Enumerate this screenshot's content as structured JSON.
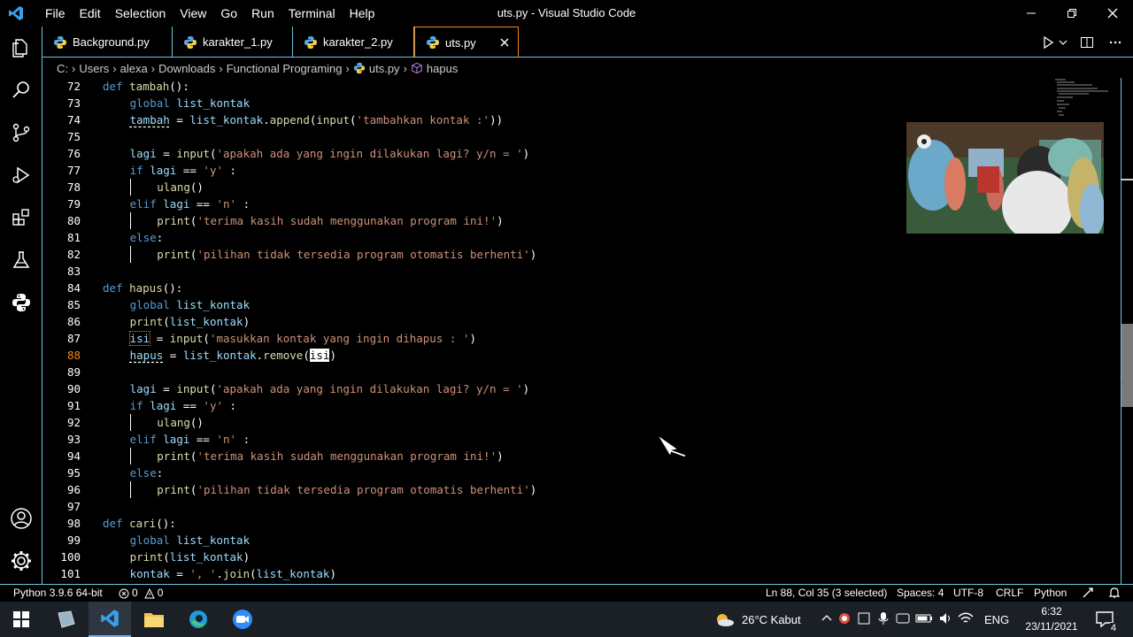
{
  "window": {
    "title": "uts.py - Visual Studio Code",
    "menu": [
      "File",
      "Edit",
      "Selection",
      "View",
      "Go",
      "Run",
      "Terminal",
      "Help"
    ]
  },
  "activity_bar": [
    "explorer-icon",
    "search-icon",
    "source-control-icon",
    "run-debug-icon",
    "extensions-icon",
    "testing-icon",
    "python-icon",
    "account-icon",
    "manage-gear-icon"
  ],
  "tabs": [
    {
      "label": "Background.py",
      "active": false
    },
    {
      "label": "karakter_1.py",
      "active": false
    },
    {
      "label": "karakter_2.py",
      "active": false
    },
    {
      "label": "uts.py",
      "active": true
    }
  ],
  "breadcrumb": [
    "C:",
    "Users",
    "alexa",
    "Downloads",
    "Functional Programing",
    "uts.py",
    "hapus"
  ],
  "editor": {
    "current_line": 88,
    "lines": [
      {
        "n": "72",
        "tokens": [
          [
            "kw",
            "def "
          ],
          [
            "fn",
            "tambah"
          ],
          [
            "pl",
            "():"
          ]
        ]
      },
      {
        "n": "73",
        "tokens": [
          [
            "kw",
            "global "
          ],
          [
            "var",
            "list_kontak"
          ]
        ]
      },
      {
        "n": "74",
        "tokens": [
          [
            "var",
            "tambah"
          ],
          [
            "pl",
            " = "
          ],
          [
            "var",
            "list_kontak"
          ],
          [
            "pl",
            "."
          ],
          [
            "fn",
            "append"
          ],
          [
            "pl",
            "("
          ],
          [
            "fn",
            "input"
          ],
          [
            "pl",
            "("
          ],
          [
            "str",
            "'tambahkan kontak :'"
          ],
          [
            "pl",
            "))"
          ]
        ]
      },
      {
        "n": "75",
        "tokens": []
      },
      {
        "n": "76",
        "tokens": [
          [
            "var",
            "lagi"
          ],
          [
            "pl",
            " = "
          ],
          [
            "fn",
            "input"
          ],
          [
            "pl",
            "("
          ],
          [
            "str",
            "'apakah ada yang ingin dilakukan lagi? y/n = '"
          ],
          [
            "pl",
            ")"
          ]
        ]
      },
      {
        "n": "77",
        "tokens": [
          [
            "kw",
            "if "
          ],
          [
            "var",
            "lagi"
          ],
          [
            "pl",
            " == "
          ],
          [
            "str",
            "'y'"
          ],
          [
            "pl",
            " :"
          ]
        ]
      },
      {
        "n": "78",
        "tokens": [
          [
            "fn",
            "ulang"
          ],
          [
            "pl",
            "()"
          ]
        ]
      },
      {
        "n": "79",
        "tokens": [
          [
            "kw",
            "elif "
          ],
          [
            "var",
            "lagi"
          ],
          [
            "pl",
            " == "
          ],
          [
            "str",
            "'n'"
          ],
          [
            "pl",
            " :"
          ]
        ]
      },
      {
        "n": "80",
        "tokens": [
          [
            "fn",
            "print"
          ],
          [
            "pl",
            "("
          ],
          [
            "str",
            "'terima kasih sudah menggunakan program ini!'"
          ],
          [
            "pl",
            ")"
          ]
        ]
      },
      {
        "n": "81",
        "tokens": [
          [
            "kw",
            "else"
          ],
          [
            "pl",
            ":"
          ]
        ]
      },
      {
        "n": "82",
        "tokens": [
          [
            "fn",
            "print"
          ],
          [
            "pl",
            "("
          ],
          [
            "str",
            "'pilihan tidak tersedia program otomatis berhenti'"
          ],
          [
            "pl",
            ")"
          ]
        ]
      },
      {
        "n": "83",
        "tokens": []
      },
      {
        "n": "84",
        "tokens": [
          [
            "kw",
            "def "
          ],
          [
            "fn",
            "hapus"
          ],
          [
            "pl",
            "():"
          ]
        ]
      },
      {
        "n": "85",
        "tokens": [
          [
            "kw",
            "global "
          ],
          [
            "var",
            "list_kontak"
          ]
        ]
      },
      {
        "n": "86",
        "tokens": [
          [
            "fn",
            "print"
          ],
          [
            "pl",
            "("
          ],
          [
            "var",
            "list_kontak"
          ],
          [
            "pl",
            ")"
          ]
        ]
      },
      {
        "n": "87",
        "tokens": [
          [
            "var",
            "isi"
          ],
          [
            "pl",
            " = "
          ],
          [
            "fn",
            "input"
          ],
          [
            "pl",
            "("
          ],
          [
            "str",
            "'masukkan kontak yang ingin dihapus : '"
          ],
          [
            "pl",
            ")"
          ]
        ]
      },
      {
        "n": "88",
        "tokens": [
          [
            "var",
            "hapus"
          ],
          [
            "pl",
            " = "
          ],
          [
            "var",
            "list_kontak"
          ],
          [
            "pl",
            "."
          ],
          [
            "fn",
            "remove"
          ],
          [
            "pl",
            "("
          ],
          [
            "var",
            "isi"
          ],
          [
            "pl",
            ")"
          ]
        ]
      },
      {
        "n": "89",
        "tokens": []
      },
      {
        "n": "90",
        "tokens": [
          [
            "var",
            "lagi"
          ],
          [
            "pl",
            " = "
          ],
          [
            "fn",
            "input"
          ],
          [
            "pl",
            "("
          ],
          [
            "str",
            "'apakah ada yang ingin dilakukan lagi? y/n = '"
          ],
          [
            "pl",
            ")"
          ]
        ]
      },
      {
        "n": "91",
        "tokens": [
          [
            "kw",
            "if "
          ],
          [
            "var",
            "lagi"
          ],
          [
            "pl",
            " == "
          ],
          [
            "str",
            "'y'"
          ],
          [
            "pl",
            " :"
          ]
        ]
      },
      {
        "n": "92",
        "tokens": [
          [
            "fn",
            "ulang"
          ],
          [
            "pl",
            "()"
          ]
        ]
      },
      {
        "n": "93",
        "tokens": [
          [
            "kw",
            "elif "
          ],
          [
            "var",
            "lagi"
          ],
          [
            "pl",
            " == "
          ],
          [
            "str",
            "'n'"
          ],
          [
            "pl",
            " :"
          ]
        ]
      },
      {
        "n": "94",
        "tokens": [
          [
            "fn",
            "print"
          ],
          [
            "pl",
            "("
          ],
          [
            "str",
            "'terima kasih sudah menggunakan program ini!'"
          ],
          [
            "pl",
            ")"
          ]
        ]
      },
      {
        "n": "95",
        "tokens": [
          [
            "kw",
            "else"
          ],
          [
            "pl",
            ":"
          ]
        ]
      },
      {
        "n": "96",
        "tokens": [
          [
            "fn",
            "print"
          ],
          [
            "pl",
            "("
          ],
          [
            "str",
            "'pilihan tidak tersedia program otomatis berhenti'"
          ],
          [
            "pl",
            ")"
          ]
        ]
      },
      {
        "n": "97",
        "tokens": []
      },
      {
        "n": "98",
        "tokens": [
          [
            "kw",
            "def "
          ],
          [
            "fn",
            "cari"
          ],
          [
            "pl",
            "():"
          ]
        ]
      },
      {
        "n": "99",
        "tokens": [
          [
            "kw",
            "global "
          ],
          [
            "var",
            "list_kontak"
          ]
        ]
      },
      {
        "n": "100",
        "tokens": [
          [
            "fn",
            "print"
          ],
          [
            "pl",
            "("
          ],
          [
            "var",
            "list_kontak"
          ],
          [
            "pl",
            ")"
          ]
        ]
      },
      {
        "n": "101",
        "tokens": [
          [
            "var",
            "kontak"
          ],
          [
            "pl",
            " = "
          ],
          [
            "str",
            "', '"
          ],
          [
            "pl",
            "."
          ],
          [
            "fn",
            "join"
          ],
          [
            "pl",
            "("
          ],
          [
            "var",
            "list_kontak"
          ],
          [
            "pl",
            ")"
          ]
        ]
      }
    ]
  },
  "statusbar": {
    "interpreter": "Python 3.9.6 64-bit",
    "errors": "0",
    "warnings": "0",
    "position": "Ln 88, Col 35 (3 selected)",
    "spaces": "Spaces: 4",
    "encoding": "UTF-8",
    "eol": "CRLF",
    "language": "Python"
  },
  "taskbar": {
    "weather": "26°C  Kabut",
    "language": "ENG",
    "time": "6:32",
    "date": "23/11/2021",
    "notifications": "4"
  },
  "colors": {
    "border_accent": "#6fc3df",
    "active_tab_border": "#f38518",
    "keyword": "#569cd6",
    "function": "#dcdcaa",
    "variable": "#9cdcfe",
    "string": "#ce9178"
  }
}
